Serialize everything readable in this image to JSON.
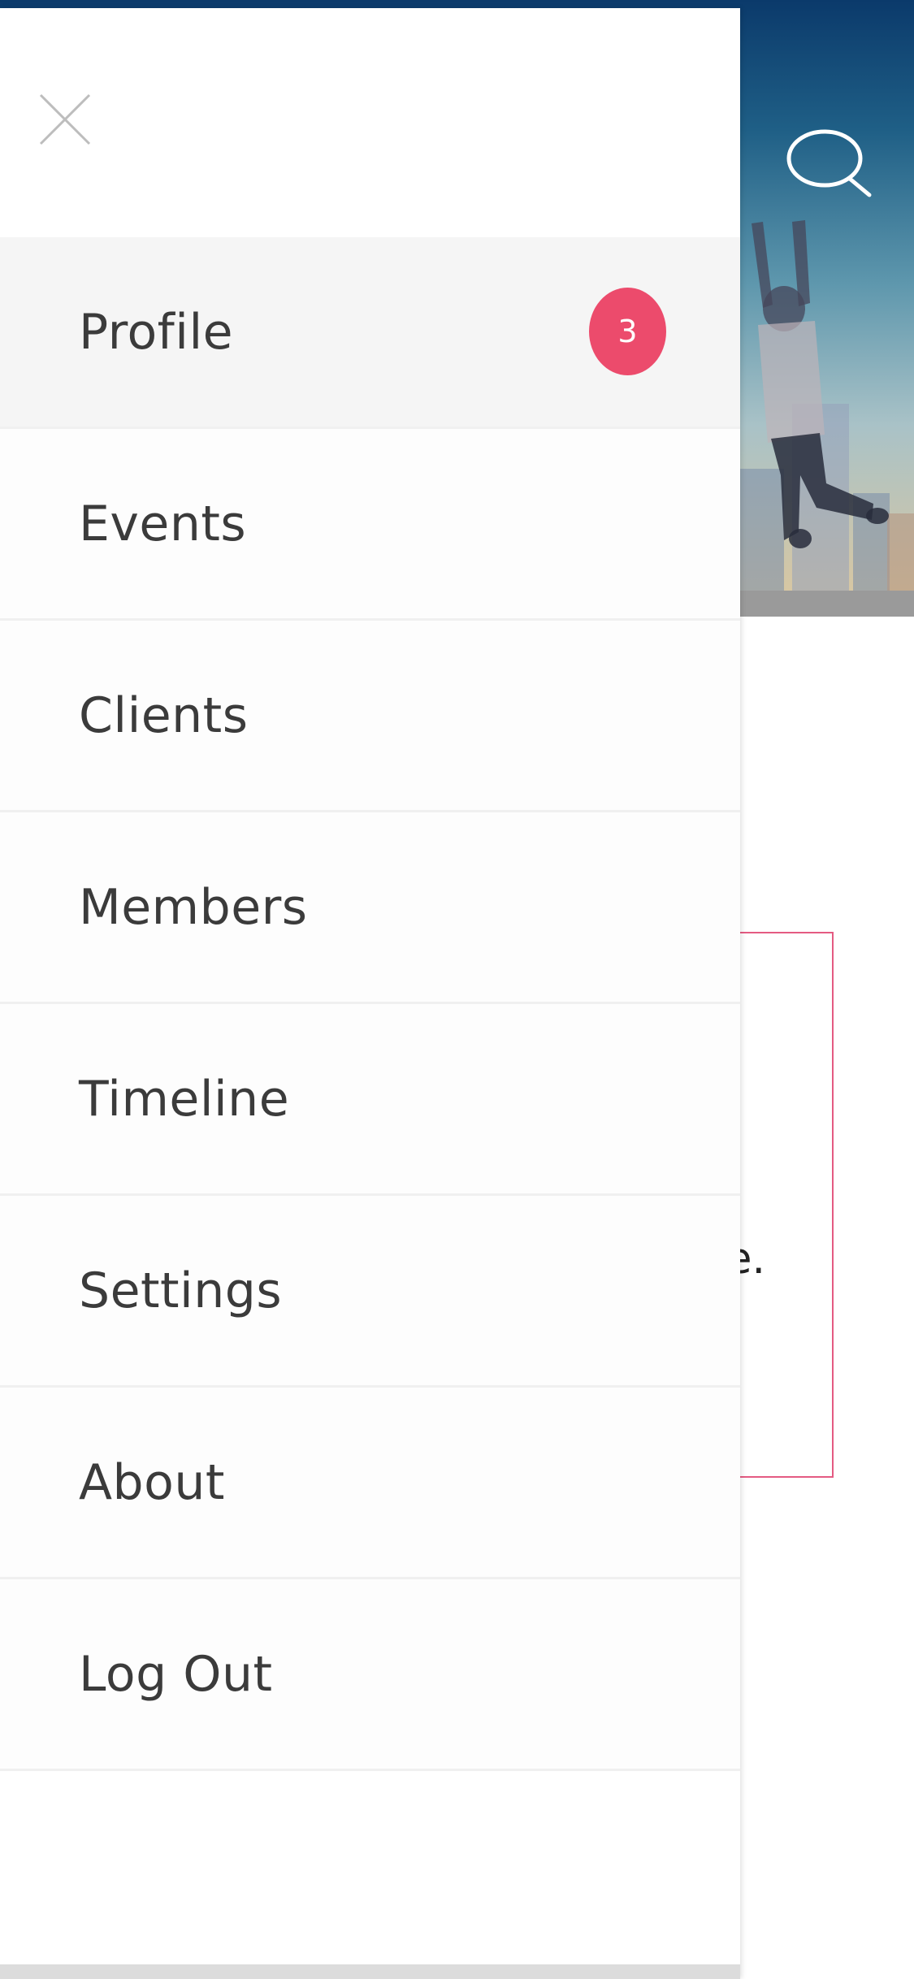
{
  "icons": {
    "close": "close-icon",
    "search": "search-icon"
  },
  "colors": {
    "badge": "#ec4b6c",
    "card_border": "#e45b82",
    "menu_text": "#3b3b3b",
    "active_row": "#f5f5f5"
  },
  "background": {
    "card_text_fragment": "e."
  },
  "drawer": {
    "menu": [
      {
        "label": "Profile",
        "badge": "3",
        "active": true
      },
      {
        "label": "Events"
      },
      {
        "label": "Clients"
      },
      {
        "label": "Members"
      },
      {
        "label": "Timeline"
      },
      {
        "label": "Settings"
      },
      {
        "label": "About"
      },
      {
        "label": "Log Out"
      }
    ]
  }
}
